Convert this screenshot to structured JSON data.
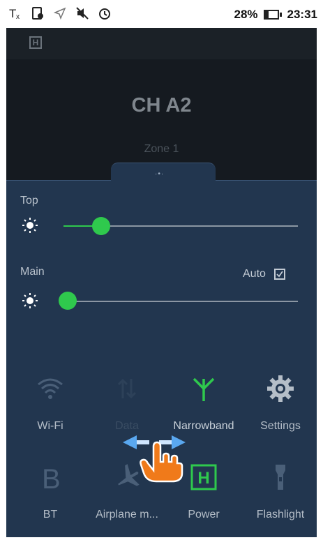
{
  "status_bar": {
    "icons": [
      "no-sim-icon",
      "sim-card-icon",
      "location-off-icon",
      "mute-icon",
      "alarm-icon"
    ],
    "battery_percent": "28%",
    "battery_fill": 0.28,
    "time": "23:31"
  },
  "header": {
    "badge": "H",
    "channel": "CH A2",
    "zone": "Zone 1"
  },
  "sliders": {
    "top": {
      "label": "Top",
      "level": 0.16
    },
    "main": {
      "label": "Main",
      "level": 0.03,
      "auto_label": "Auto",
      "auto_checked": true
    }
  },
  "toggles": [
    {
      "label": "Wi-Fi",
      "icon": "wifi-icon",
      "state": "off"
    },
    {
      "label": "Data",
      "icon": "data-icon",
      "state": "disabled"
    },
    {
      "label": "Narrowband",
      "icon": "antenna-icon",
      "state": "on"
    },
    {
      "label": "Settings",
      "icon": "gear-icon",
      "state": "off"
    },
    {
      "label": "BT",
      "icon": "bluetooth-icon",
      "state": "off"
    },
    {
      "label": "Airplane m...",
      "icon": "airplane-icon",
      "state": "off"
    },
    {
      "label": "Power",
      "icon": "power-h-icon",
      "power_letter": "H",
      "state": "on"
    },
    {
      "label": "Flashlight",
      "icon": "flashlight-icon",
      "state": "off"
    }
  ],
  "colors": {
    "accent_green": "#2fc94d",
    "panel_bg": "#22364f",
    "gesture_hand": "#f07a1a",
    "gesture_arrow": "#5aa8f0"
  }
}
